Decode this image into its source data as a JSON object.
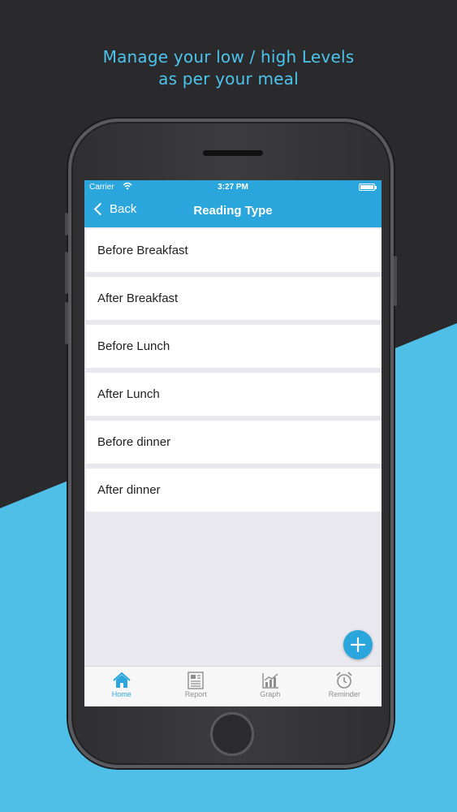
{
  "promo": {
    "line1": "Manage your low / high Levels",
    "line2": "as per your meal"
  },
  "status_bar": {
    "carrier": "Carrier",
    "time": "3:27 PM"
  },
  "nav": {
    "back_label": "Back",
    "title": "Reading Type"
  },
  "reading_types": [
    "Before Breakfast",
    "After Breakfast",
    "Before Lunch",
    "After Lunch",
    "Before dinner",
    "After dinner"
  ],
  "tabs": [
    {
      "label": "Home",
      "icon": "home-icon",
      "active": true
    },
    {
      "label": "Report",
      "icon": "report-icon",
      "active": false
    },
    {
      "label": "Graph",
      "icon": "graph-icon",
      "active": false
    },
    {
      "label": "Reminder",
      "icon": "alarm-clock-icon",
      "active": false
    }
  ],
  "colors": {
    "accent": "#2aa6dd",
    "promo_text": "#4cc3ec",
    "background_dark": "#2a2a2c",
    "background_blue": "#4fbfe8"
  }
}
